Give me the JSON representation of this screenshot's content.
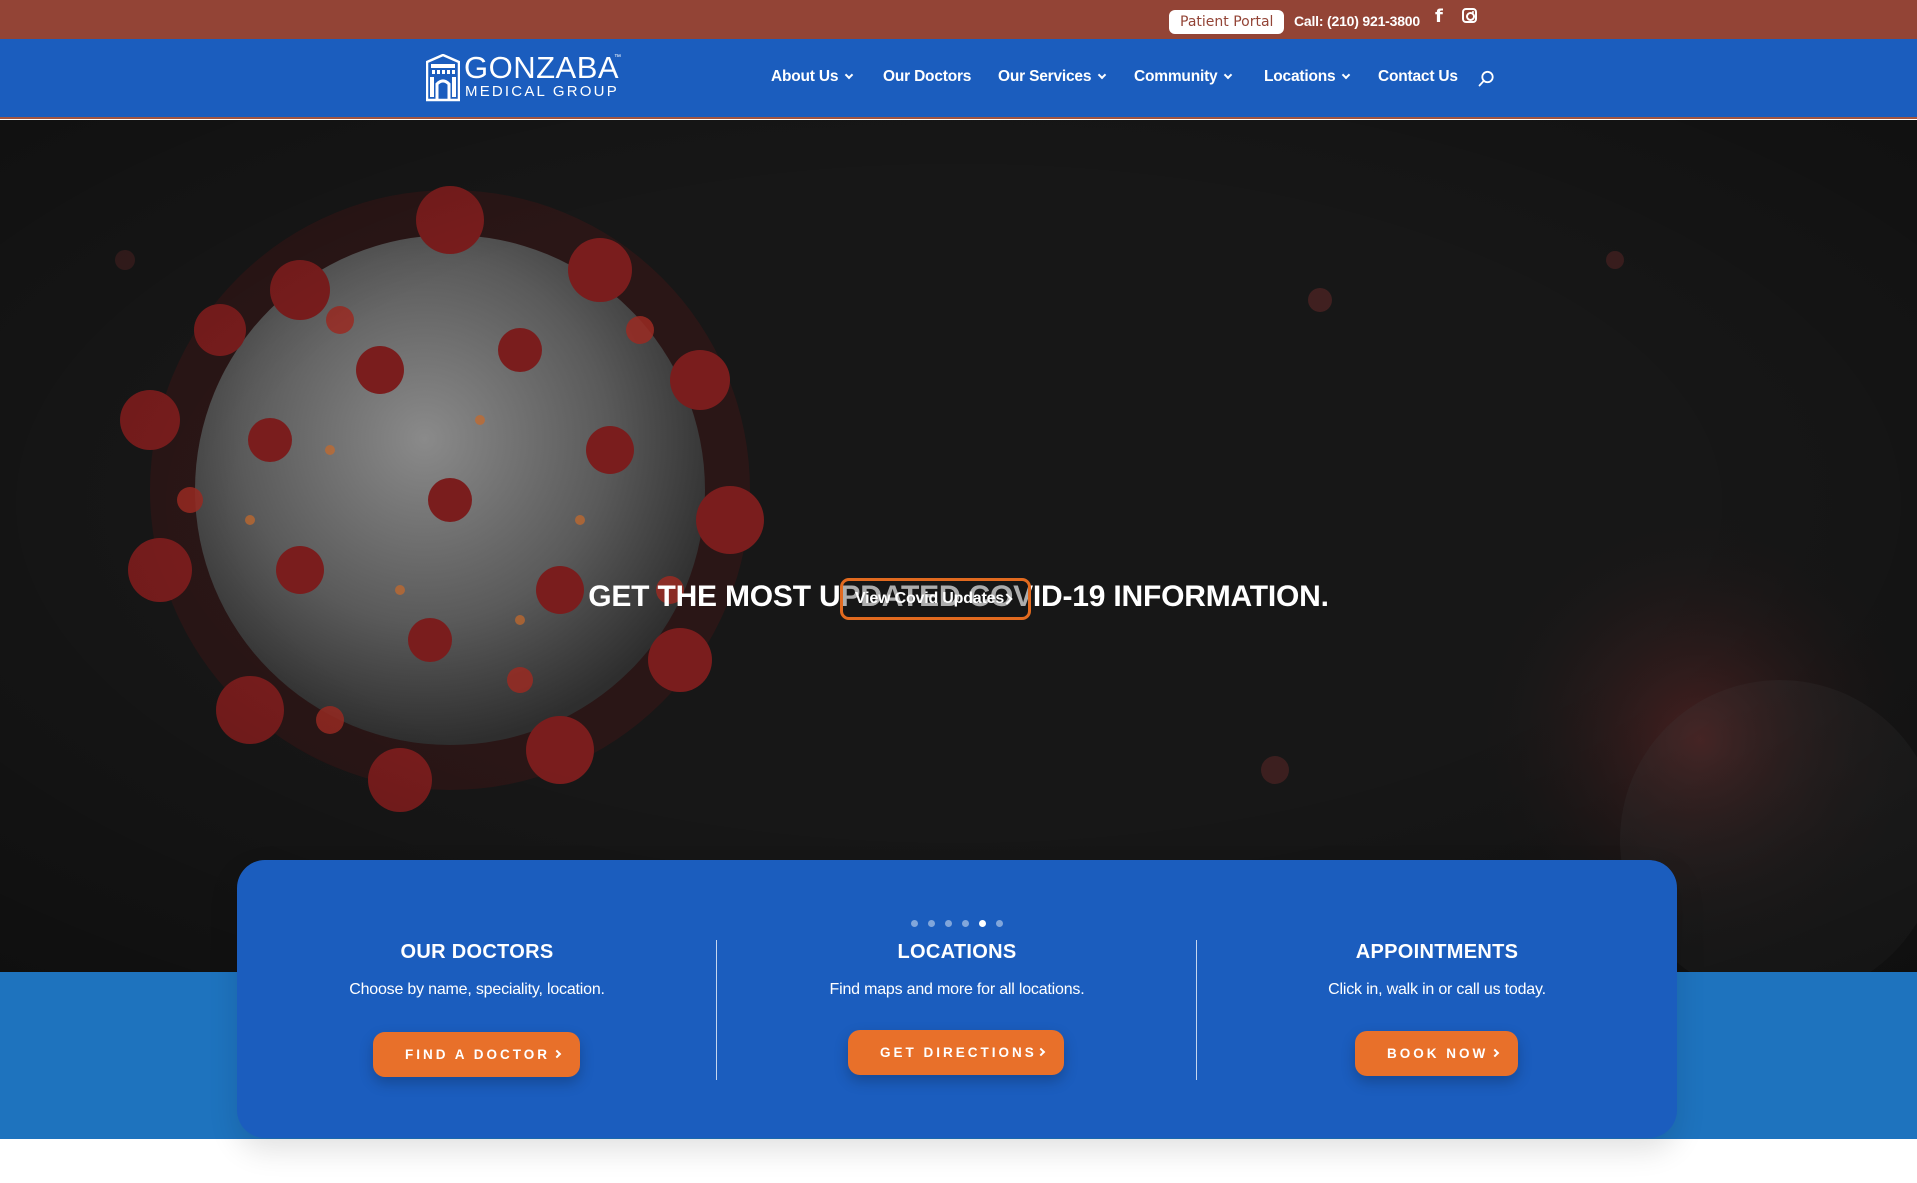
{
  "topbar": {
    "patient_portal": "Patient Portal",
    "call": "Call: (210) 921-3800",
    "facebook_glyph": "f",
    "icons": [
      "facebook-icon",
      "instagram-icon"
    ]
  },
  "header": {
    "logo": {
      "word": "GONZABA",
      "tm": "™",
      "sub": "MEDICAL GROUP"
    },
    "nav": [
      {
        "label": "About Us",
        "dropdown": true
      },
      {
        "label": "Our Doctors",
        "dropdown": false
      },
      {
        "label": "Our Services",
        "dropdown": true
      },
      {
        "label": "Community",
        "dropdown": true
      },
      {
        "label": "Locations",
        "dropdown": true
      },
      {
        "label": "Contact Us",
        "dropdown": false
      }
    ],
    "search_icon": "search-icon"
  },
  "hero": {
    "title": "GET THE MOST UPDATED COVID-19 INFORMATION.",
    "button": "View Covid Updates"
  },
  "slider": {
    "dots": 6,
    "active_dot": 5
  },
  "cards": [
    {
      "title": "OUR DOCTORS",
      "subtitle": "Choose by name, speciality, location.",
      "button": "FIND A DOCTOR"
    },
    {
      "title": "LOCATIONS",
      "subtitle": "Find maps and more for all locations.",
      "button": "GET DIRECTIONS"
    },
    {
      "title": "APPOINTMENTS",
      "subtitle": "Click in, walk in or call us today.",
      "button": "BOOK NOW"
    }
  ],
  "colors": {
    "topbar": "#934436",
    "header": "#1b5dbe",
    "accent_orange": "#e8702a",
    "hero_bg": "#171717",
    "band_blue": "#1e73be"
  }
}
